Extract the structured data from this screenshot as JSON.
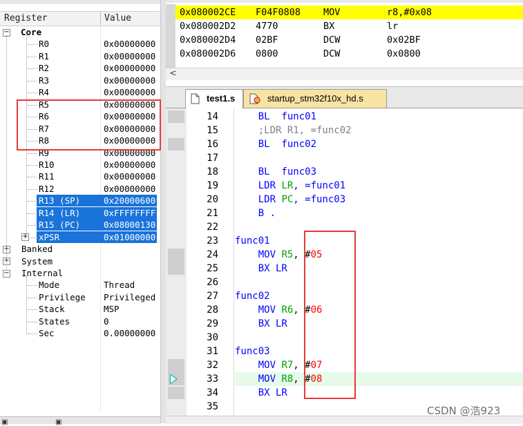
{
  "registers_panel": {
    "header": {
      "col_register": "Register",
      "col_value": "Value"
    },
    "core_label": "Core",
    "core_regs": [
      {
        "name": "R0",
        "value": "0x00000000"
      },
      {
        "name": "R1",
        "value": "0x00000000"
      },
      {
        "name": "R2",
        "value": "0x00000000"
      },
      {
        "name": "R3",
        "value": "0x00000000"
      },
      {
        "name": "R4",
        "value": "0x00000000"
      },
      {
        "name": "R5",
        "value": "0x00000000"
      },
      {
        "name": "R6",
        "value": "0x00000000"
      },
      {
        "name": "R7",
        "value": "0x00000000"
      },
      {
        "name": "R8",
        "value": "0x00000000"
      },
      {
        "name": "R9",
        "value": "0x00000000"
      },
      {
        "name": "R10",
        "value": "0x00000000"
      },
      {
        "name": "R11",
        "value": "0x00000000"
      },
      {
        "name": "R12",
        "value": "0x00000000"
      },
      {
        "name": "R13 (SP)",
        "value": "0x20000600"
      },
      {
        "name": "R14 (LR)",
        "value": "0xFFFFFFFF"
      },
      {
        "name": "R15 (PC)",
        "value": "0x08000130"
      },
      {
        "name": "xPSR",
        "value": "0x01000000"
      }
    ],
    "banked_label": "Banked",
    "system_label": "System",
    "internal_label": "Internal",
    "internal_items": [
      {
        "name": "Mode",
        "value": "Thread"
      },
      {
        "name": "Privilege",
        "value": "Privileged"
      },
      {
        "name": "Stack",
        "value": "MSP"
      },
      {
        "name": "States",
        "value": "0"
      },
      {
        "name": "Sec",
        "value": "0.00000000"
      }
    ]
  },
  "disassembly": {
    "rows": [
      {
        "addr": "0x080002CE",
        "code": "F04F0808",
        "mnem": "MOV",
        "ops": "r8,#0x08",
        "highlight": true
      },
      {
        "addr": "0x080002D2",
        "code": "4770",
        "mnem": "BX",
        "ops": "lr",
        "highlight": false
      },
      {
        "addr": "0x080002D4",
        "code": "02BF",
        "mnem": "DCW",
        "ops": "0x02BF",
        "highlight": false
      },
      {
        "addr": "0x080002D6",
        "code": "0800",
        "mnem": "DCW",
        "ops": "0x0800",
        "highlight": false
      }
    ],
    "scroll_left_glyph": "<",
    "highlight_color": "#ffff00"
  },
  "editor_tabs": [
    {
      "label": "test1.s",
      "active": true,
      "icon": "file-icon"
    },
    {
      "label": "startup_stm32f10x_hd.s",
      "active": false,
      "icon": "file-modified-icon"
    }
  ],
  "editor": {
    "lines": [
      {
        "n": "14",
        "tokens": [
          {
            "t": "    ",
            "c": "plain"
          },
          {
            "t": "BL",
            "c": "kw"
          },
          {
            "t": "  func01",
            "c": "kw"
          }
        ]
      },
      {
        "n": "15",
        "tokens": [
          {
            "t": "    ",
            "c": "plain"
          },
          {
            "t": ";LDR R1, =func02",
            "c": "cm"
          }
        ]
      },
      {
        "n": "16",
        "tokens": [
          {
            "t": "    ",
            "c": "plain"
          },
          {
            "t": "BL",
            "c": "kw"
          },
          {
            "t": "  func02",
            "c": "kw"
          }
        ]
      },
      {
        "n": "17",
        "tokens": []
      },
      {
        "n": "18",
        "tokens": [
          {
            "t": "    ",
            "c": "plain"
          },
          {
            "t": "BL",
            "c": "kw"
          },
          {
            "t": "  func03",
            "c": "kw"
          }
        ]
      },
      {
        "n": "19",
        "tokens": [
          {
            "t": "    ",
            "c": "plain"
          },
          {
            "t": "LDR ",
            "c": "kw"
          },
          {
            "t": "LR",
            "c": "reg"
          },
          {
            "t": ", =func01",
            "c": "kw"
          }
        ]
      },
      {
        "n": "20",
        "tokens": [
          {
            "t": "    ",
            "c": "plain"
          },
          {
            "t": "LDR ",
            "c": "kw"
          },
          {
            "t": "PC",
            "c": "reg"
          },
          {
            "t": ", =func03",
            "c": "kw"
          }
        ]
      },
      {
        "n": "21",
        "tokens": [
          {
            "t": "    ",
            "c": "plain"
          },
          {
            "t": "B .",
            "c": "kw"
          }
        ]
      },
      {
        "n": "22",
        "tokens": []
      },
      {
        "n": "23",
        "tokens": [
          {
            "t": "func01",
            "c": "kw"
          }
        ]
      },
      {
        "n": "24",
        "tokens": [
          {
            "t": "    ",
            "c": "plain"
          },
          {
            "t": "MOV ",
            "c": "kw"
          },
          {
            "t": "R5",
            "c": "reg"
          },
          {
            "t": ", #",
            "c": "plain"
          },
          {
            "t": "05",
            "c": "num"
          }
        ]
      },
      {
        "n": "25",
        "tokens": [
          {
            "t": "    ",
            "c": "plain"
          },
          {
            "t": "BX LR",
            "c": "kw"
          }
        ]
      },
      {
        "n": "26",
        "tokens": []
      },
      {
        "n": "27",
        "tokens": [
          {
            "t": "func02",
            "c": "kw"
          }
        ]
      },
      {
        "n": "28",
        "tokens": [
          {
            "t": "    ",
            "c": "plain"
          },
          {
            "t": "MOV ",
            "c": "kw"
          },
          {
            "t": "R6",
            "c": "reg"
          },
          {
            "t": ", #",
            "c": "plain"
          },
          {
            "t": "06",
            "c": "num"
          }
        ]
      },
      {
        "n": "29",
        "tokens": [
          {
            "t": "    ",
            "c": "plain"
          },
          {
            "t": "BX LR",
            "c": "kw"
          }
        ]
      },
      {
        "n": "30",
        "tokens": []
      },
      {
        "n": "31",
        "tokens": [
          {
            "t": "func03",
            "c": "kw"
          }
        ]
      },
      {
        "n": "32",
        "tokens": [
          {
            "t": "    ",
            "c": "plain"
          },
          {
            "t": "MOV ",
            "c": "kw"
          },
          {
            "t": "R7",
            "c": "reg"
          },
          {
            "t": ", #",
            "c": "plain"
          },
          {
            "t": "07",
            "c": "num"
          }
        ]
      },
      {
        "n": "33",
        "tokens": [
          {
            "t": "    ",
            "c": "plain"
          },
          {
            "t": "MOV ",
            "c": "kw"
          },
          {
            "t": "R8",
            "c": "reg"
          },
          {
            "t": ", #",
            "c": "plain"
          },
          {
            "t": "08",
            "c": "num"
          }
        ],
        "current": true
      },
      {
        "n": "34",
        "tokens": [
          {
            "t": "    ",
            "c": "plain"
          },
          {
            "t": "BX LR",
            "c": "kw"
          }
        ]
      },
      {
        "n": "35",
        "tokens": []
      }
    ]
  },
  "colors": {
    "selection": "#1a73d9",
    "keyword": "#0000ff",
    "comment": "#808080",
    "number": "#ff0000",
    "register": "#00a000",
    "annotation": "#e53935",
    "current_line": "#e6fbe9"
  },
  "watermark": "CSDN @浩923"
}
